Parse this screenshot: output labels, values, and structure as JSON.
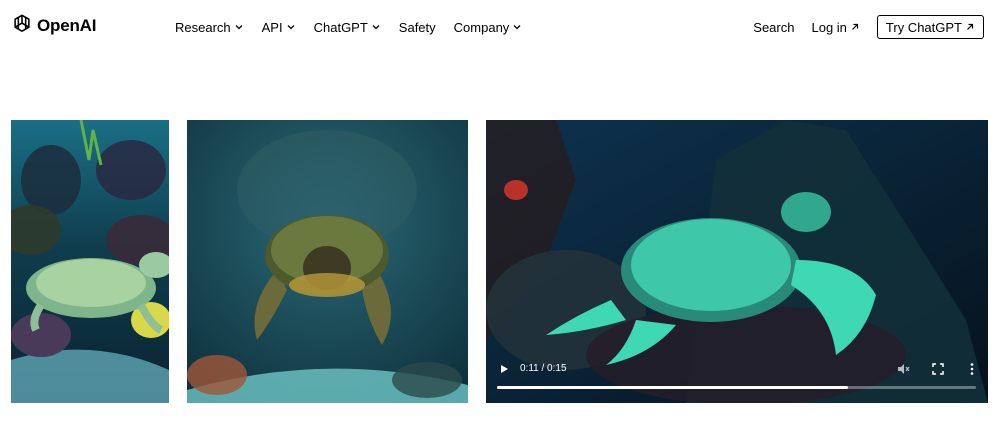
{
  "brand": {
    "name": "OpenAI",
    "icon": "openai-logo-icon"
  },
  "nav": {
    "items": [
      {
        "label": "Research",
        "dropdown": true
      },
      {
        "label": "API",
        "dropdown": true
      },
      {
        "label": "ChatGPT",
        "dropdown": true
      },
      {
        "label": "Safety",
        "dropdown": false
      },
      {
        "label": "Company",
        "dropdown": true
      }
    ],
    "search": "Search",
    "login": "Log in",
    "cta": "Try ChatGPT"
  },
  "media": [
    {
      "kind": "image",
      "subject": "sea turtle on coral reef"
    },
    {
      "kind": "image",
      "subject": "sea turtle swimming toward camera"
    },
    {
      "kind": "video",
      "subject": "sea turtle swimming over coral reef",
      "player": {
        "time": "0:11 / 0:15",
        "progress": 0.733,
        "muted": true
      }
    }
  ]
}
